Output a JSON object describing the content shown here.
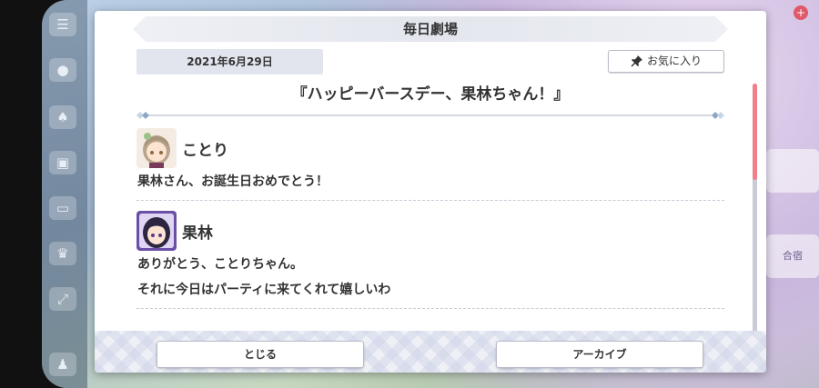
{
  "modal": {
    "title": "毎日劇場",
    "date": "2021年6月29日",
    "favorite_label": "お気に入り",
    "episode_title": "『ハッピーバースデー、果林ちゃん！』"
  },
  "messages": [
    {
      "speaker": "ことり",
      "lines": [
        "果林さん、お誕生日おめでとう！"
      ]
    },
    {
      "speaker": "果林",
      "lines": [
        "ありがとう、ことりちゃん。",
        "それに今日はパーティに来てくれて嬉しいわ"
      ]
    }
  ],
  "footer": {
    "close_label": "とじる",
    "archive_label": "アーカイブ"
  },
  "background": {
    "side_label_1": "合宿"
  },
  "colors": {
    "scroll_thumb": "#ef7f88",
    "badge": "#e0586a"
  }
}
